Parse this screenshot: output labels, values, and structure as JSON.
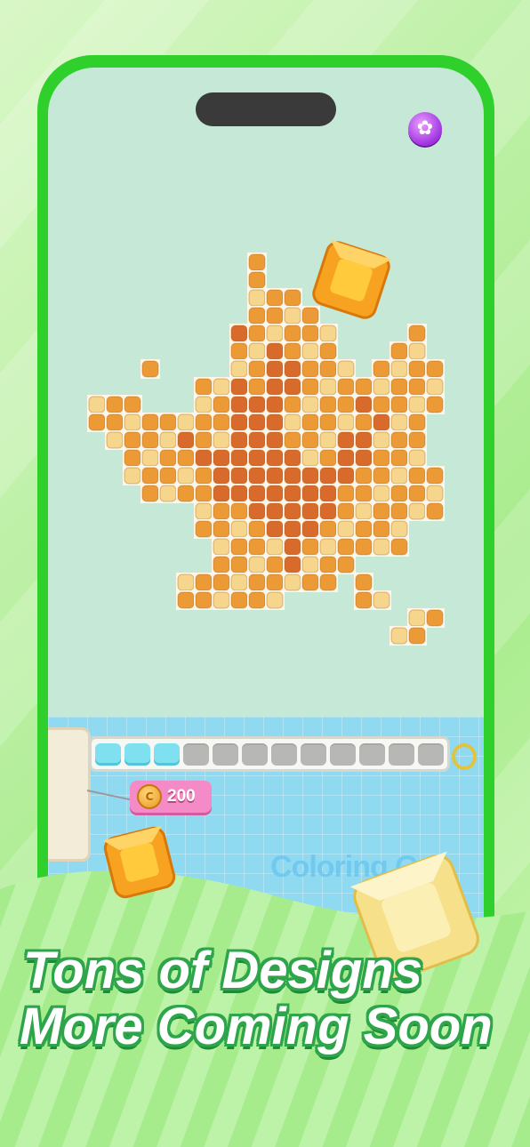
{
  "headline": {
    "line1": "Tons of Designs",
    "line2": "More Coming Soon"
  },
  "game": {
    "settings_icon": "gear-icon",
    "tray_slots_total": 12,
    "tray_slots_filled": 3,
    "price_tag_value": "200",
    "price_icon": "coin-icon",
    "logo_text": "Coloring Go!"
  },
  "colors": {
    "phone_frame": "#2fd02b",
    "screen_bg": "#c6e8d7",
    "dark_orange": "#d86a2c",
    "orange": "#eb9a35",
    "light_yellow": "#f5d68c",
    "tray_filled": "#7fe1ef",
    "tag_pink": "#f48bc6"
  }
}
